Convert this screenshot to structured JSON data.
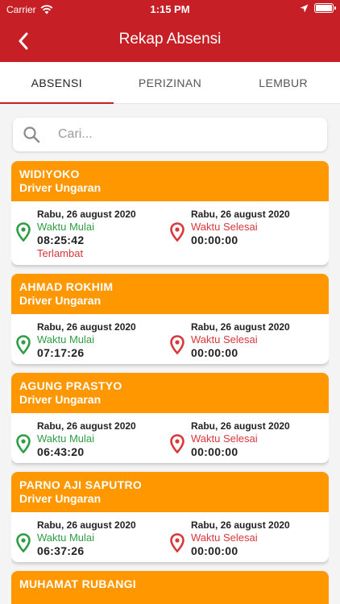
{
  "status": {
    "carrier": "Carrier",
    "time": "1:15 PM"
  },
  "header": {
    "title": "Rekap Absensi"
  },
  "tabs": [
    {
      "label": "ABSENSI",
      "active": true
    },
    {
      "label": "PERIZINAN",
      "active": false
    },
    {
      "label": "LEMBUR",
      "active": false
    }
  ],
  "search": {
    "placeholder": "Cari..."
  },
  "colors": {
    "header": "#c62026",
    "card_header": "#ff9800",
    "start": "#2e9d44",
    "end": "#d9373a"
  },
  "records": [
    {
      "name": "WIDIYOKO",
      "role": "Driver Ungaran",
      "start_date": "Rabu, 26 august 2020",
      "start_label": "Waktu Mulai",
      "start_time": "08:25:42",
      "note": "Terlambat",
      "end_date": "Rabu, 26 august 2020",
      "end_label": "Waktu Selesai",
      "end_time": "00:00:00"
    },
    {
      "name": "AHMAD ROKHIM",
      "role": "Driver Ungaran",
      "start_date": "Rabu, 26 august 2020",
      "start_label": "Waktu Mulai",
      "start_time": "07:17:26",
      "note": "",
      "end_date": "Rabu, 26 august 2020",
      "end_label": "Waktu Selesai",
      "end_time": "00:00:00"
    },
    {
      "name": "AGUNG PRASTYO",
      "role": "Driver Ungaran",
      "start_date": "Rabu, 26 august 2020",
      "start_label": "Waktu Mulai",
      "start_time": "06:43:20",
      "note": "",
      "end_date": "Rabu, 26 august 2020",
      "end_label": "Waktu Selesai",
      "end_time": "00:00:00"
    },
    {
      "name": "PARNO AJI SAPUTRO",
      "role": "Driver Ungaran",
      "start_date": "Rabu, 26 august 2020",
      "start_label": "Waktu Mulai",
      "start_time": "06:37:26",
      "note": "",
      "end_date": "Rabu, 26 august 2020",
      "end_label": "Waktu Selesai",
      "end_time": "00:00:00"
    },
    {
      "name": "MUHAMAT RUBANGI",
      "role": "",
      "start_date": "",
      "start_label": "",
      "start_time": "",
      "note": "",
      "end_date": "",
      "end_label": "",
      "end_time": ""
    }
  ]
}
